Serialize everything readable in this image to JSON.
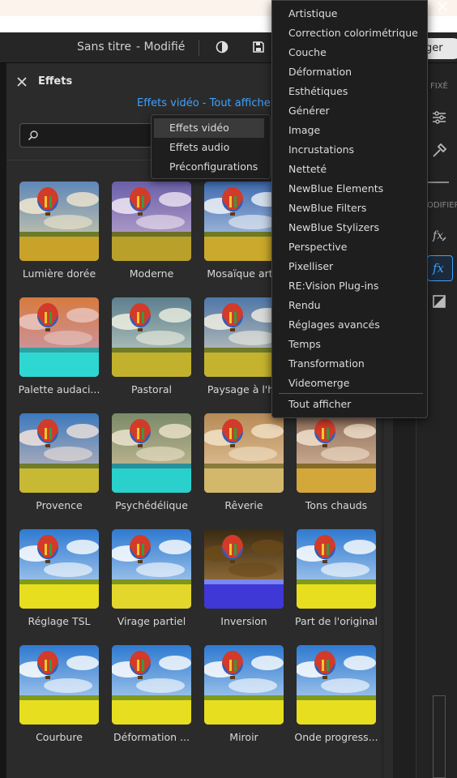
{
  "titlebar": {
    "doc_title": "Sans titre",
    "status": "- Modifié",
    "share_partial": "ger"
  },
  "panel": {
    "title": "Effets",
    "breadcrumb": "Effets vidéo - Tout afficher",
    "search": {
      "value": "",
      "placeholder": ""
    }
  },
  "right_panel": {
    "label_fixed": "FIXÉ",
    "label_modify": "ODIFIER"
  },
  "type_menu": {
    "items": [
      "Effets vidéo",
      "Effets audio",
      "Préconfigurations"
    ],
    "selected": "Effets vidéo"
  },
  "category_menu": {
    "items": [
      "Artistique",
      "Correction colorimétrique",
      "Couche",
      "Déformation",
      "Esthétiques",
      "Générer",
      "Image",
      "Incrustations",
      "Netteté",
      "NewBlue Elements",
      "NewBlue Filters",
      "NewBlue Stylizers",
      "Perspective",
      "Pixelliser",
      "RE:Vision Plug-ins",
      "Rendu",
      "Réglages avancés",
      "Temps",
      "Transformation",
      "Videomerge"
    ],
    "show_all": "Tout afficher"
  },
  "effects": [
    {
      "label": "Lumière dorée"
    },
    {
      "label": "Moderne"
    },
    {
      "label": "Mosaïque artis"
    },
    {
      "label": ""
    },
    {
      "label": "Palette audaci..."
    },
    {
      "label": "Pastoral"
    },
    {
      "label": "Paysage à l'hu"
    },
    {
      "label": ""
    },
    {
      "label": "Provence"
    },
    {
      "label": "Psychédélique"
    },
    {
      "label": "Rêverie"
    },
    {
      "label": "Tons chauds"
    },
    {
      "label": "Réglage TSL"
    },
    {
      "label": "Virage partiel"
    },
    {
      "label": "Inversion"
    },
    {
      "label": "Part de l'original"
    },
    {
      "label": "Courbure"
    },
    {
      "label": "Déformation ..."
    },
    {
      "label": "Miroir"
    },
    {
      "label": "Onde progress..."
    }
  ],
  "colors": {
    "accent": "#3ea2ff",
    "panel_bg": "#2b2b2b",
    "menu_bg": "#1e1e1e"
  }
}
